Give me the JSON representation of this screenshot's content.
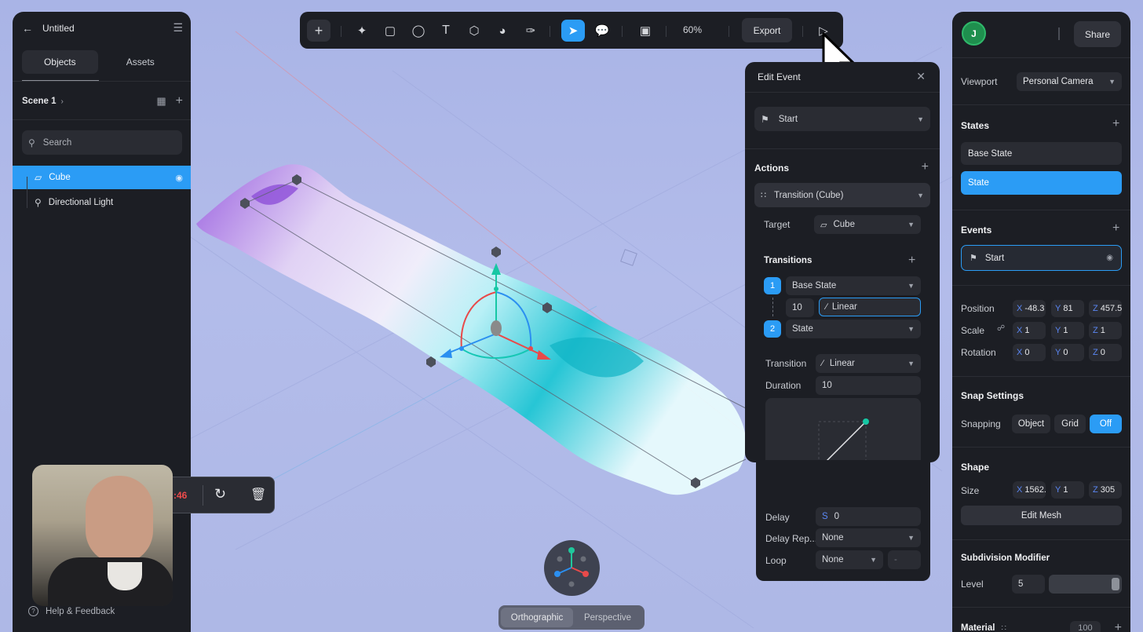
{
  "left_panel": {
    "title": "Untitled",
    "tabs": [
      {
        "label": "Objects",
        "active": true
      },
      {
        "label": "Assets",
        "active": false
      }
    ],
    "scene": "Scene 1",
    "search_placeholder": "Search",
    "objects": [
      {
        "label": "Cube",
        "selected": true,
        "icon": "cube-outline-icon"
      },
      {
        "label": "Directional Light",
        "selected": false,
        "icon": "light-icon"
      }
    ],
    "help": "Help & Feedback"
  },
  "toolbar": {
    "zoom": "60%",
    "export": "Export"
  },
  "recording": {
    "timer": ":46"
  },
  "view_modes": [
    "Orthographic",
    "Perspective"
  ],
  "edit_event": {
    "title": "Edit Event",
    "trigger": "Start",
    "actions_title": "Actions",
    "action": "Transition (Cube)",
    "target_label": "Target",
    "target_value": "Cube",
    "transitions_title": "Transitions",
    "steps": [
      {
        "num": "1",
        "state": "Base State"
      },
      {
        "num": "2",
        "state": "State"
      }
    ],
    "step_duration": "10",
    "step_easing": "Linear",
    "transition_label": "Transition",
    "transition_value": "Linear",
    "duration_label": "Duration",
    "duration_value": "10",
    "delay_label": "Delay",
    "delay_prefix": "S",
    "delay_value": "0",
    "delay_repeat_label": "Delay Rep...",
    "delay_repeat_value": "None",
    "loop_label": "Loop",
    "loop_value": "None",
    "loop_extra": "-"
  },
  "right_panel": {
    "avatar": "J",
    "share": "Share",
    "viewport_label": "Viewport",
    "viewport_value": "Personal Camera",
    "states_title": "States",
    "states": [
      {
        "label": "Base State",
        "active": false
      },
      {
        "label": "State",
        "active": true
      }
    ],
    "events_title": "Events",
    "event": "Start",
    "position_label": "Position",
    "position": {
      "x": "-48.3",
      "y": "81",
      "z": "457.5"
    },
    "scale_label": "Scale",
    "scale": {
      "x": "1",
      "y": "1",
      "z": "1"
    },
    "rotation_label": "Rotation",
    "rotation": {
      "x": "0",
      "y": "0",
      "z": "0"
    },
    "snap_title": "Snap Settings",
    "snapping_label": "Snapping",
    "snap_options": [
      "Object",
      "Grid",
      "Off"
    ],
    "snap_active": "Off",
    "shape_title": "Shape",
    "size_label": "Size",
    "size": {
      "x": "1562.",
      "y": "1",
      "z": "305"
    },
    "edit_mesh": "Edit Mesh",
    "subdiv_title": "Subdivision Modifier",
    "level_label": "Level",
    "level_value": "5",
    "material_title": "Material",
    "material_value": "100"
  },
  "colors": {
    "accent": "#2b9cf5",
    "panel": "#1c1e24",
    "field": "#2a2c33"
  }
}
